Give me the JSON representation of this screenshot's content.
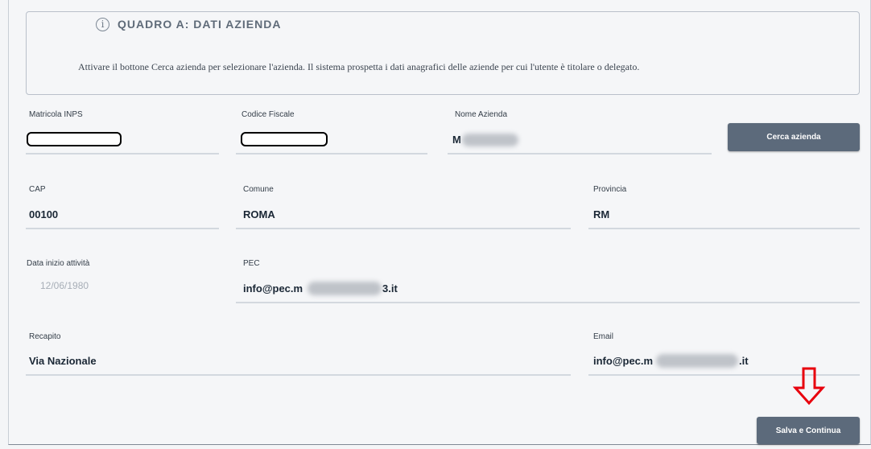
{
  "section": {
    "title": "QUADRO A: DATI AZIENDA",
    "info": "Attivare il bottone Cerca azienda per selezionare l'azienda. Il sistema prospetta i dati anagrafici delle aziende per cui l'utente è titolare o delegato."
  },
  "fields": {
    "matricola": {
      "label": "Matricola INPS",
      "value": ""
    },
    "codice_fiscale": {
      "label": "Codice Fiscale",
      "value": ""
    },
    "nome_azienda": {
      "label": "Nome Azienda",
      "value": "M"
    },
    "cap": {
      "label": "CAP",
      "value": "00100"
    },
    "comune": {
      "label": "Comune",
      "value": "ROMA"
    },
    "provincia": {
      "label": "Provincia",
      "value": "RM"
    },
    "data_inizio": {
      "label": "Data inizio attività",
      "value": "12/06/1980"
    },
    "pec": {
      "label": "PEC",
      "value_start": "info@pec.m",
      "value_end": "3.it"
    },
    "recapito": {
      "label": "Recapito",
      "value": "Via Nazionale"
    },
    "email": {
      "label": "Email",
      "value_start": "info@pec.m",
      "value_end": ".it"
    }
  },
  "buttons": {
    "cerca": "Cerca azienda",
    "salva": "Salva e Continua"
  },
  "colors": {
    "button": "#5c6a7b",
    "arrow": "#e8000d"
  }
}
